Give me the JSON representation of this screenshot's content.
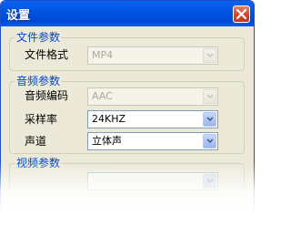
{
  "window": {
    "title": "设置"
  },
  "file_params": {
    "title": "文件参数",
    "format_label": "文件格式",
    "format_value": "MP4"
  },
  "audio_params": {
    "title": "音频参数",
    "codec_label": "音频编码",
    "codec_value": "AAC",
    "samplerate_label": "采样率",
    "samplerate_value": "24KHZ",
    "channel_label": "声道",
    "channel_value": "立体声"
  },
  "video_params": {
    "title": "视频参数"
  },
  "colors": {
    "titlebar": "#0053e1",
    "group_title": "#0046d5",
    "dialog_bg": "#ece9d8"
  },
  "icons": [
    "close-icon",
    "chevron-down-icon"
  ]
}
